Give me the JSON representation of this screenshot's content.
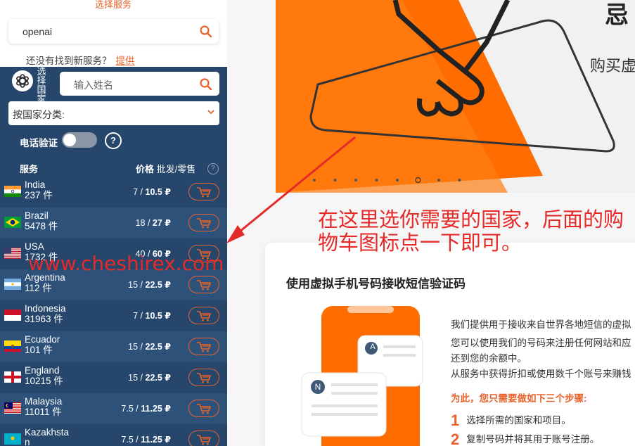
{
  "top": {
    "heading": "选择服务",
    "search_value": "openai",
    "not_found_text": "还没有找到新服务？",
    "not_found_link": "提供"
  },
  "panel": {
    "choose_country_label": "选择国家",
    "name_search_placeholder": "输入姓名",
    "country_filter_label": "按国家分类:",
    "phone_verify_label": "电话验证",
    "phone_verify_on": false,
    "help_glyph": "?",
    "col_services": "服务",
    "col_price_bold": "价格",
    "col_price_rest": " 批发/零售",
    "col_help_glyph": "?",
    "rows": [
      {
        "name": "India",
        "count": "237 件",
        "wholesale": "7",
        "retail": "10.5 ₽",
        "flag": "flag-india-icon"
      },
      {
        "name": "Brazil",
        "count": "5478 件",
        "wholesale": "18",
        "retail": "27 ₽",
        "flag": "flag-brazil-icon"
      },
      {
        "name": "USA",
        "count": "1732 件",
        "wholesale": "40",
        "retail": "60 ₽",
        "flag": "flag-usa-icon"
      },
      {
        "name": "Argentina",
        "count": "112 件",
        "wholesale": "15",
        "retail": "22.5 ₽",
        "flag": "flag-argentina-icon"
      },
      {
        "name": "Indonesia",
        "count": "31963 件",
        "wholesale": "7",
        "retail": "10.5 ₽",
        "flag": "flag-indonesia-icon"
      },
      {
        "name": "Ecuador",
        "count": "101 件",
        "wholesale": "15",
        "retail": "22.5 ₽",
        "flag": "flag-ecuador-icon"
      },
      {
        "name": "England",
        "count": "10215 件",
        "wholesale": "15",
        "retail": "22.5 ₽",
        "flag": "flag-england-icon"
      },
      {
        "name": "Malaysia",
        "count": "11011 件",
        "wholesale": "7.5",
        "retail": "11.25 ₽",
        "flag": "flag-malaysia-icon"
      },
      {
        "name": "Kazakhsta\nn",
        "count": "",
        "wholesale": "7.5",
        "retail": "11.25 ₽",
        "flag": "flag-kazakhstan-icon"
      }
    ]
  },
  "banner": {
    "corner_char": "忌",
    "promo_text": "购买虚",
    "dots_count": 8,
    "active_dot": 5
  },
  "annotation": {
    "text": "在这里选你需要的国家，后面的购物车图标点一下即可。",
    "watermark": "www.cheshirex.com"
  },
  "card": {
    "title": "使用虚拟手机号码接收短信验证码",
    "paragraph_lines": [
      "我们提供用于接收来自世界各地短信的虚拟",
      "您可以使用我们的号码来注册任何网站和应",
      "还到您的余额中。",
      "从服务中获得折扣或使用数千个账号来赚钱"
    ],
    "steps_title": "为此，您只需要做如下三个步骤:",
    "steps": [
      {
        "num": "1",
        "text": "选择所需的国家和项目。"
      },
      {
        "num": "2",
        "text": "复制号码并将其用于账号注册。"
      }
    ],
    "bubble_a": "A",
    "bubble_n": "N"
  },
  "colors": {
    "accent": "#e8632b",
    "panel_bg": "#26476b",
    "panel_row_alt": "#2d5179",
    "annotation_red": "#e52a2a"
  }
}
